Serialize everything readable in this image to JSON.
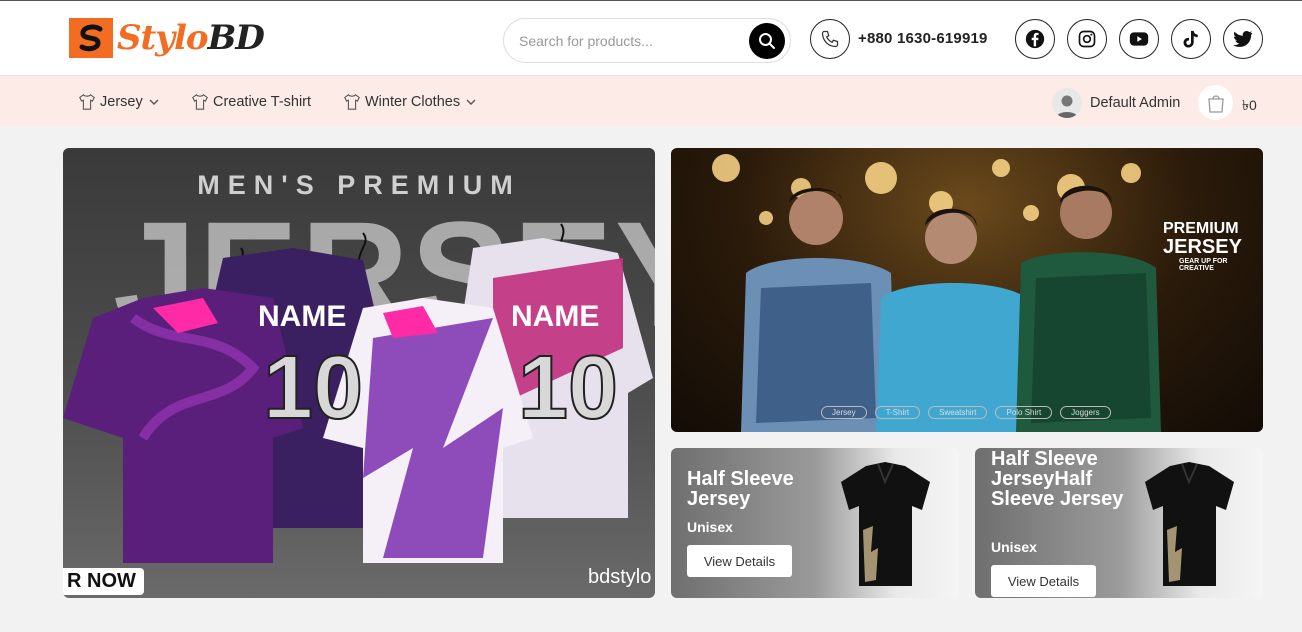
{
  "brand": {
    "logo_part1": "Stylo",
    "logo_part2": "BD",
    "accent": "#f26c22"
  },
  "search": {
    "placeholder": "Search for products..."
  },
  "contact": {
    "phone": "+880 1630-619919"
  },
  "social": [
    "facebook-icon",
    "instagram-icon",
    "youtube-icon",
    "tiktok-icon",
    "twitter-icon"
  ],
  "nav": {
    "items": [
      {
        "label": "Jersey",
        "has_dropdown": true
      },
      {
        "label": "Creative T-shirt",
        "has_dropdown": false
      },
      {
        "label": "Winter Clothes",
        "has_dropdown": true
      }
    ],
    "user_name": "Default Admin",
    "cart_total": "৳0",
    "bg": "#fcebe6"
  },
  "hero_left": {
    "headline": "MEN'S PREMIUM",
    "big_text": "JERSEY",
    "jersey_name": "NAME",
    "jersey_number": "10",
    "badge": "R NOW",
    "watermark": "bdstylo"
  },
  "hero_right": {
    "premium": "PREMIUM",
    "jersey": "JERSEY",
    "tagline": "GEAR UP FOR CREATIVE",
    "pills": [
      "Jersey",
      "T-Shirt",
      "Sweatshirt",
      "Polo Shirt",
      "Joggers"
    ]
  },
  "promo_cards": [
    {
      "title": "Half Sleeve Jersey",
      "subtitle": "Unisex",
      "button": "View Details"
    },
    {
      "title": "Half Sleeve JerseyHalf Sleeve Jersey",
      "subtitle": "Unisex",
      "button": "View Details"
    }
  ]
}
